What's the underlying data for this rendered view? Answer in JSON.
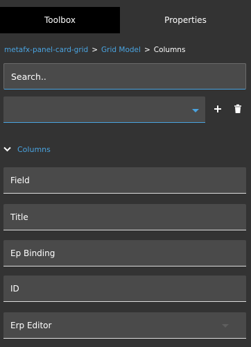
{
  "tabs": [
    {
      "label": "Toolbox",
      "active": true
    },
    {
      "label": "Properties",
      "active": false
    }
  ],
  "breadcrumb": {
    "items": [
      "metafx-panel-card-grid",
      "Grid Model",
      "Columns"
    ],
    "separator": ">"
  },
  "search": {
    "placeholder": "Search.."
  },
  "select": {
    "value": ""
  },
  "actions": {
    "add_icon": "plus-icon",
    "delete_icon": "trash-icon"
  },
  "section": {
    "title": "Columns",
    "expanded": true,
    "icon": "chevron-down-icon"
  },
  "fields": [
    {
      "label": "Field"
    },
    {
      "label": "Title"
    },
    {
      "label": "Ep Binding"
    },
    {
      "label": "ID"
    },
    {
      "label": "Erp Editor",
      "has_dropdown": true
    }
  ],
  "colors": {
    "background": "#333333",
    "active_tab": "#000000",
    "accent": "#4aa3df",
    "input_bg": "#4a4a4a"
  }
}
